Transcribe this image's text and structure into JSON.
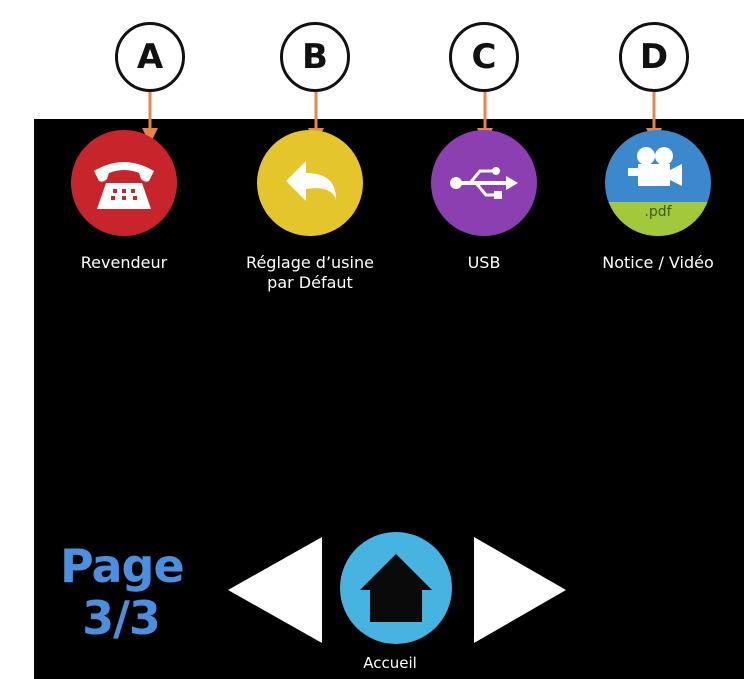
{
  "callouts": [
    "A",
    "B",
    "C",
    "D"
  ],
  "apps": [
    {
      "label": "Revendeur",
      "icon": "telephone-icon",
      "color": "#c8242c"
    },
    {
      "label": "Réglage d’usine\npar Défaut",
      "icon": "undo-arrow-icon",
      "color": "#e4c52c"
    },
    {
      "label": "USB",
      "icon": "usb-icon",
      "color": "#8b3fb0"
    },
    {
      "label": "Notice / Vidéo",
      "icon": "video-camera-icon",
      "color": "#3c88cc",
      "badge": ".pdf",
      "badge_color": "#a2c93c"
    }
  ],
  "page": {
    "label_line1": "Page",
    "label_line2": "3/3",
    "color": "#4b8fe0"
  },
  "nav": {
    "prev": "previous-arrow-icon",
    "home_label": "Accueil",
    "next": "next-arrow-icon"
  },
  "colors": {
    "arrow": "#e6844a",
    "screen": "#000000",
    "home": "#46b3e0"
  }
}
